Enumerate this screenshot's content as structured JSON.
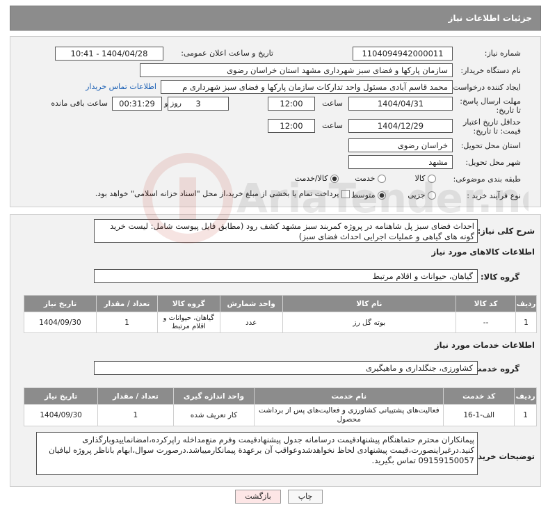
{
  "header": {
    "title": "جزئیات اطلاعات نیاز"
  },
  "form": {
    "need_number_label": "شماره نیاز:",
    "need_number": "1104094942000011",
    "announce_label": "تاریخ و ساعت اعلان عمومی:",
    "announce_value": "1404/04/28 - 10:41",
    "buyer_org_label": "نام دستگاه خریدار:",
    "buyer_org": "سازمان پارکها و فضای سبز شهرداری مشهد استان خراسان رضوی",
    "creator_label": "ایجاد کننده درخواست:",
    "creator": "محمد قاسم آبادی مسئول واحد تدارکات سازمان پارکها و فضای سبز شهرداری م",
    "contact_link": "اطلاعات تماس خریدار",
    "deadline_label": "مهلت ارسال پاسخ: تا تاریخ:",
    "deadline_date": "1404/04/31",
    "time_word": "ساعت",
    "deadline_time": "12:00",
    "days_value": "3",
    "days_label": "روز و",
    "remaining_time": "00:31:29",
    "remaining_label": "ساعت باقی مانده",
    "validity_label": "حداقل تاریخ اعتبار قیمت: تا تاریخ:",
    "validity_date": "1404/12/29",
    "validity_time": "12:00",
    "province_label": "استان محل تحویل:",
    "province": "خراسان رضوی",
    "city_label": "شهر محل تحویل:",
    "city": "مشهد",
    "category_label": "طبقه بندی موضوعی:",
    "category_options": [
      "کالا",
      "خدمت",
      "کالا/خدمت"
    ],
    "process_label": "نوع فرآیند خرید :",
    "process_options": [
      "جزیی",
      "متوسط"
    ],
    "payment_note": "پرداخت تمام یا بخشی از مبلغ خرید،از محل \"اسناد خزانه اسلامی\" خواهد بود."
  },
  "description": {
    "label": "شرح کلی نیاز:",
    "text": "احداث فضای سبز پل شاهنامه در پروژه کمربند سبز مشهد کشف رود (مطابق فایل پیوست شامل: لیست خرید گونه های گیاهی و عملیات اجرایی احداث فضای سبز)"
  },
  "goods": {
    "section_title": "اطلاعات کالاهای مورد نیاز",
    "group_label": "گروه کالا:",
    "group_value": "گیاهان، حیوانات و اقلام مرتبط",
    "columns": [
      "ردیف",
      "کد کالا",
      "نام کالا",
      "واحد شمارش",
      "گروه کالا",
      "تعداد / مقدار",
      "تاریخ نیاز"
    ],
    "rows": [
      {
        "row": "1",
        "code": "--",
        "name": "بوته گل رز",
        "unit": "عدد",
        "group": "گیاهان، حیوانات و اقلام مرتبط",
        "qty": "1",
        "date": "1404/09/30"
      }
    ]
  },
  "services": {
    "section_title": "اطلاعات خدمات مورد نیاز",
    "group_label": "گروه خدمت:",
    "group_value": "کشاورزی، جنگلداری و ماهیگیری",
    "columns": [
      "ردیف",
      "کد خدمت",
      "نام خدمت",
      "واحد اندازه گیری",
      "تعداد / مقدار",
      "تاریخ نیاز"
    ],
    "rows": [
      {
        "row": "1",
        "code": "الف-1-16",
        "name": "فعالیت‌های پشتیبانی کشاورزی و فعالیت‌های پس از برداشت محصول",
        "unit": "کار تعریف شده",
        "qty": "1",
        "date": "1404/09/30"
      }
    ]
  },
  "notes": {
    "label": "توضیحات خریدار:",
    "text": "پیمانکاران محترم حتماهنگام پیشنهادقیمت درسامانه جدول پیشنهادقیمت وفرم منع‌مداخله راپرکرده،امضانماییدوبارگذاری کنید.درغیراینصورت،قیمت پیشنهادی لحاظ نخواهدشدوعواقب آن برعهدة پیمانکارمیباشد.درصورت سوال،ابهام باناظر پروژه لیافیان 09159150057 تماس بگیرید."
  },
  "buttons": {
    "print": "چاپ",
    "back": "بازگشت"
  },
  "watermark": "AriaTender.neT"
}
